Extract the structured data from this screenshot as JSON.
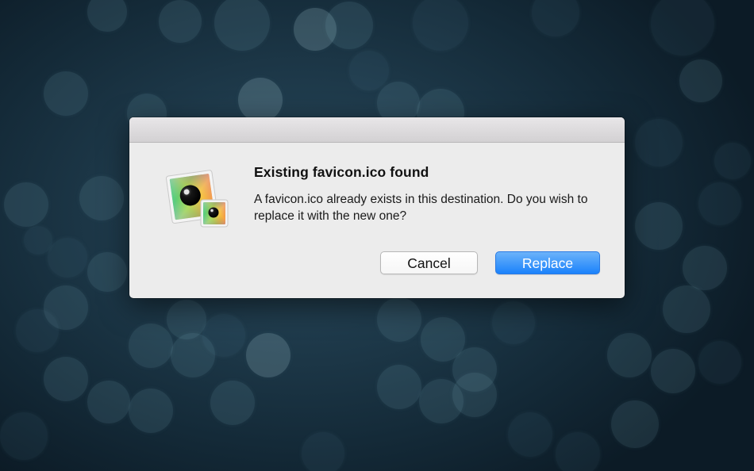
{
  "dialog": {
    "title": "Existing favicon.ico found",
    "message": "A favicon.ico already exists in this destination. Do you wish to replace it with the new one?",
    "icon": "favicon-app-icon",
    "buttons": {
      "cancel_label": "Cancel",
      "replace_label": "Replace"
    },
    "colors": {
      "default_button": "#1a82fb",
      "dialog_background": "#ececec"
    }
  }
}
